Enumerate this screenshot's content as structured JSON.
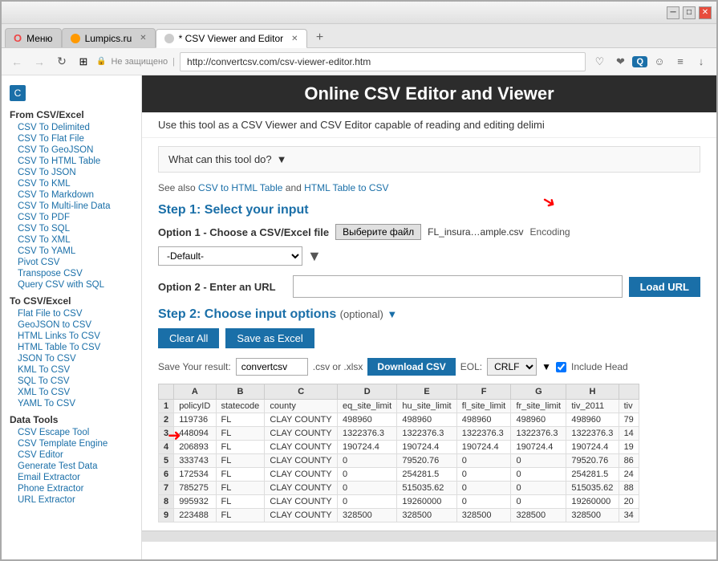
{
  "browser": {
    "titlebar_buttons": [
      "min",
      "max",
      "close"
    ],
    "tabs": [
      {
        "label": "Меню",
        "favicon": "opera",
        "active": false
      },
      {
        "label": "Lumpics.ru",
        "favicon": "lumpics",
        "active": false
      },
      {
        "label": "* CSV Viewer and Editor",
        "favicon": "csv",
        "active": true
      }
    ],
    "new_tab_label": "+",
    "address": "http://convertcsv.com/csv-viewer-editor.htm",
    "lock_icon": "🔒",
    "not_secure": "Не защищено"
  },
  "sidebar": {
    "from_section_title": "From CSV/Excel",
    "from_links": [
      "CSV To Delimited",
      "CSV To Flat File",
      "CSV To GeoJSON",
      "CSV To HTML Table",
      "CSV To JSON",
      "CSV To KML",
      "CSV To Markdown",
      "CSV To Multi-line Data",
      "CSV To PDF",
      "CSV To SQL",
      "CSV To XML",
      "CSV To YAML",
      "Pivot CSV",
      "Transpose CSV",
      "Query CSV with SQL"
    ],
    "to_section_title": "To CSV/Excel",
    "to_links": [
      "Flat File to CSV",
      "GeoJSON to CSV",
      "HTML Links To CSV",
      "HTML Table To CSV",
      "JSON To CSV",
      "KML To CSV",
      "SQL To CSV",
      "XML To CSV",
      "YAML To CSV"
    ],
    "data_section_title": "Data Tools",
    "data_links": [
      "CSV Escape Tool",
      "CSV Template Engine",
      "CSV Editor",
      "Generate Test Data",
      "Email Extractor",
      "Phone Extractor",
      "URL Extractor"
    ]
  },
  "header": {
    "title": "Online CSV Editor and Viewer",
    "subtitle": "Use this tool as a CSV Viewer and CSV Editor capable of reading and editing delimi"
  },
  "tool": {
    "dropdown_label": "What can this tool do?",
    "dropdown_arrow": "▼",
    "also_see_prefix": "See also ",
    "also_see_link1": "CSV to HTML Table",
    "also_see_and": " and ",
    "also_see_link2": "HTML Table to CSV",
    "step1_title": "Step 1: Select your input",
    "option1_label": "Option 1 - Choose a CSV/Excel file",
    "file_btn_label": "Выберите файл",
    "file_name": "FL_insura…ample.csv",
    "encoding_label": "Encoding",
    "select_default": "-Default-",
    "option2_label": "Option 2 - Enter an URL",
    "url_placeholder": "",
    "load_url_label": "Load URL",
    "step2_title": "Step 2: Choose input options",
    "step2_optional": "(optional)",
    "step2_arrow": "▼",
    "clear_all_label": "Clear All",
    "save_excel_label": "Save as Excel",
    "save_result_label": "Save Your result:",
    "save_name_value": "convertcsv",
    "save_ext_label": ".csv or .xlsx",
    "download_label": "Download CSV",
    "eol_label": "EOL:",
    "eol_value": "CRLF",
    "include_header_label": "Include Head"
  },
  "table": {
    "col_headers": [
      "",
      "A",
      "B",
      "C",
      "D",
      "E",
      "F",
      "G",
      "H",
      ""
    ],
    "col_labels": [
      "",
      "policyID",
      "statecode",
      "county",
      "eq_site_limit",
      "hu_site_limit",
      "fl_site_limit",
      "fr_site_limit",
      "tiv_2011",
      "tiv"
    ],
    "rows": [
      {
        "num": "2",
        "a": "119736",
        "b": "FL",
        "c": "CLAY COUNTY",
        "d": "498960",
        "e": "498960",
        "f": "498960",
        "g": "498960",
        "h": "498960",
        "i": "79"
      },
      {
        "num": "3",
        "a": "448094",
        "b": "FL",
        "c": "CLAY COUNTY",
        "d": "1322376.3",
        "e": "1322376.3",
        "f": "1322376.3",
        "g": "1322376.3",
        "h": "1322376.3",
        "i": "14"
      },
      {
        "num": "4",
        "a": "206893",
        "b": "FL",
        "c": "CLAY COUNTY",
        "d": "190724.4",
        "e": "190724.4",
        "f": "190724.4",
        "g": "190724.4",
        "h": "190724.4",
        "i": "19"
      },
      {
        "num": "5",
        "a": "333743",
        "b": "FL",
        "c": "CLAY COUNTY",
        "d": "0",
        "e": "79520.76",
        "f": "0",
        "g": "0",
        "h": "79520.76",
        "i": "86"
      },
      {
        "num": "6",
        "a": "172534",
        "b": "FL",
        "c": "CLAY COUNTY",
        "d": "0",
        "e": "254281.5",
        "f": "0",
        "g": "0",
        "h": "254281.5",
        "i": "24"
      },
      {
        "num": "7",
        "a": "785275",
        "b": "FL",
        "c": "CLAY COUNTY",
        "d": "0",
        "e": "515035.62",
        "f": "0",
        "g": "0",
        "h": "515035.62",
        "i": "88"
      },
      {
        "num": "8",
        "a": "995932",
        "b": "FL",
        "c": "CLAY COUNTY",
        "d": "0",
        "e": "19260000",
        "f": "0",
        "g": "0",
        "h": "19260000",
        "i": "20"
      },
      {
        "num": "9",
        "a": "223488",
        "b": "FL",
        "c": "CLAY COUNTY",
        "d": "328500",
        "e": "328500",
        "f": "328500",
        "g": "328500",
        "h": "328500",
        "i": "34"
      }
    ]
  }
}
